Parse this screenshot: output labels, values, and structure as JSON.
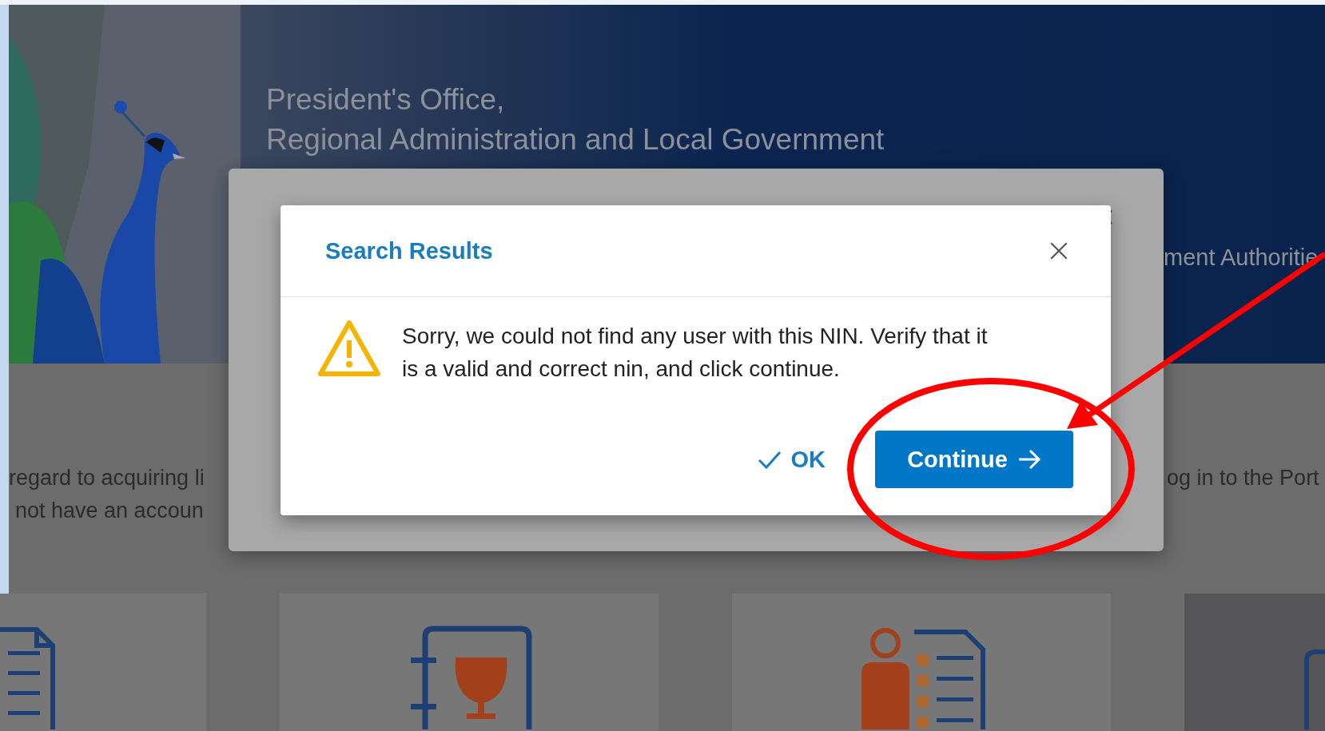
{
  "header": {
    "title_lines": [
      "President's Office,",
      "Regional Administration and Local Government"
    ]
  },
  "intro": {
    "left_lines": [
      "regard to acquiring li",
      "not have an accoun"
    ],
    "right_line": "og in to the Port"
  },
  "cards": [
    {
      "kind": "document-list"
    },
    {
      "kind": "wine-book"
    },
    {
      "kind": "person-document"
    },
    {
      "kind": "book"
    }
  ],
  "background_dialog": {
    "subtitle_fragment": "ment Authoritie"
  },
  "dialog": {
    "title": "Search Results",
    "message": "Sorry, we could not find any user with this NIN. Verify that it is a valid and correct nin, and click continue.",
    "buttons": [
      {
        "label": "OK",
        "kind": "text"
      },
      {
        "label": "Continue",
        "kind": "primary"
      }
    ]
  }
}
